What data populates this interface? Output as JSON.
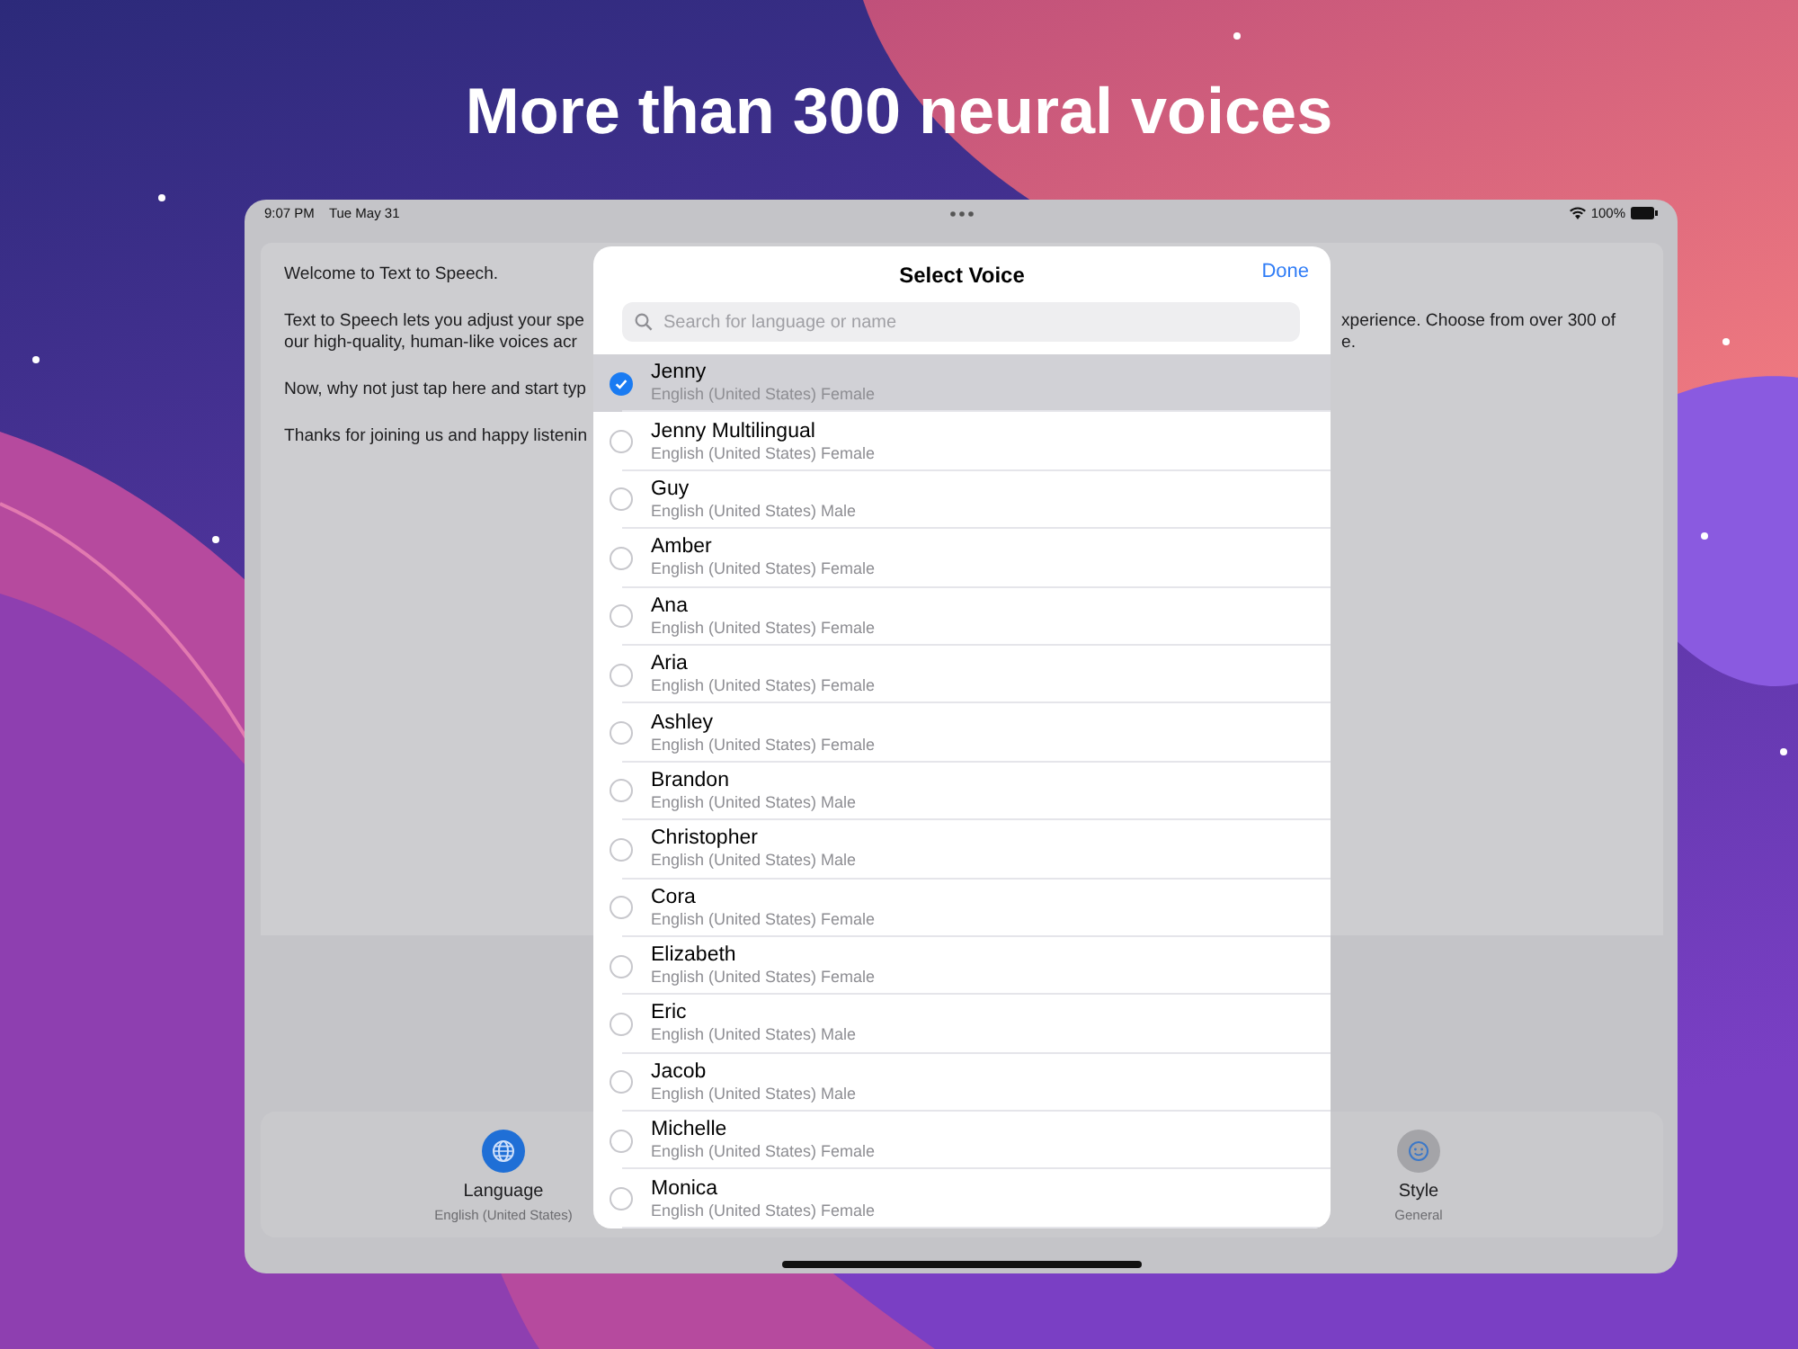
{
  "headline": "More than 300 neural voices",
  "status_bar": {
    "time": "9:07 PM",
    "date": "Tue May 31",
    "battery": "100%"
  },
  "document": {
    "paragraphs": [
      [
        {
          "left": "Welcome to Text to Speech."
        }
      ],
      [
        {
          "left": "Text to Speech lets you adjust your spe",
          "right": "xperience. Choose from over 300 of"
        },
        {
          "left": "our high-quality, human-like voices acr",
          "right": "e."
        }
      ],
      [
        {
          "left": "Now, why not just tap here and start typ"
        }
      ],
      [
        {
          "left": "Thanks for joining us and happy listenin"
        }
      ]
    ]
  },
  "toolbar": [
    {
      "kind": "language",
      "label": "Language",
      "value": "English (United States)"
    },
    {
      "kind": "style",
      "label": "Style",
      "value": "General"
    }
  ],
  "voice_sheet": {
    "title": "Select Voice",
    "done": "Done",
    "search": {
      "placeholder": "Search for language or name"
    },
    "voices": [
      {
        "name": "Jenny",
        "detail": "English (United States) Female",
        "selected": true
      },
      {
        "name": "Jenny Multilingual",
        "detail": "English (United States) Female",
        "selected": false
      },
      {
        "name": "Guy",
        "detail": "English (United States) Male",
        "selected": false
      },
      {
        "name": "Amber",
        "detail": "English (United States) Female",
        "selected": false
      },
      {
        "name": "Ana",
        "detail": "English (United States) Female",
        "selected": false
      },
      {
        "name": "Aria",
        "detail": "English (United States) Female",
        "selected": false
      },
      {
        "name": "Ashley",
        "detail": "English (United States) Female",
        "selected": false
      },
      {
        "name": "Brandon",
        "detail": "English (United States) Male",
        "selected": false
      },
      {
        "name": "Christopher",
        "detail": "English (United States) Male",
        "selected": false
      },
      {
        "name": "Cora",
        "detail": "English (United States) Female",
        "selected": false
      },
      {
        "name": "Elizabeth",
        "detail": "English (United States) Female",
        "selected": false
      },
      {
        "name": "Eric",
        "detail": "English (United States) Male",
        "selected": false
      },
      {
        "name": "Jacob",
        "detail": "English (United States) Male",
        "selected": false
      },
      {
        "name": "Michelle",
        "detail": "English (United States) Female",
        "selected": false
      },
      {
        "name": "Monica",
        "detail": "English (United States) Female",
        "selected": false
      }
    ]
  }
}
